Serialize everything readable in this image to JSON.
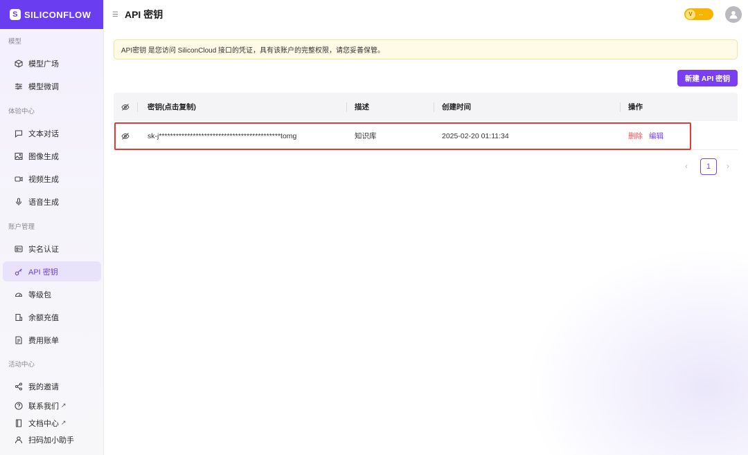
{
  "brand": {
    "name": "SILICONFLOW",
    "logo_color": "#6a3df0"
  },
  "sidebar": {
    "sections": [
      {
        "title": "模型",
        "items": [
          {
            "label": "模型广场",
            "icon": "cube-icon"
          },
          {
            "label": "模型微调",
            "icon": "sliders-icon"
          }
        ]
      },
      {
        "title": "体验中心",
        "items": [
          {
            "label": "文本对话",
            "icon": "chat-icon"
          },
          {
            "label": "图像生成",
            "icon": "image-icon"
          },
          {
            "label": "视频生成",
            "icon": "video-icon"
          },
          {
            "label": "语音生成",
            "icon": "mic-icon"
          }
        ]
      },
      {
        "title": "账户管理",
        "items": [
          {
            "label": "实名认证",
            "icon": "id-card-icon"
          },
          {
            "label": "API 密钥",
            "icon": "key-icon",
            "active": true
          },
          {
            "label": "等级包",
            "icon": "gauge-icon"
          },
          {
            "label": "余额充值",
            "icon": "wallet-icon"
          },
          {
            "label": "费用账单",
            "icon": "bill-icon"
          }
        ]
      },
      {
        "title": "活动中心",
        "items": [
          {
            "label": "我的邀请",
            "icon": "share-icon"
          },
          {
            "label": "联系我们",
            "icon": "help-circle-icon",
            "external": true
          },
          {
            "label": "文档中心",
            "icon": "book-icon",
            "external": true
          },
          {
            "label": "扫码加小助手",
            "icon": "user-icon"
          }
        ]
      }
    ],
    "external_mark": "↗"
  },
  "header": {
    "title": "API 密钥",
    "vip_badge": "--"
  },
  "notice": {
    "text": "API密钥 是您访问 SiliconCloud 接口的凭证，具有该账户的完整权限，请您妥善保管。"
  },
  "actions": {
    "new_key_label": "新建 API 密钥"
  },
  "table": {
    "columns": {
      "key": "密钥(点击复制)",
      "desc": "描述",
      "created": "创建时间",
      "ops": "操作"
    },
    "rows": [
      {
        "key": "sk-j*******************************************tomg",
        "desc": "知识库",
        "created": "2025-02-20 01:11:34",
        "delete_label": "删除",
        "edit_label": "编辑"
      }
    ]
  },
  "pagination": {
    "current_page": "1",
    "prev": "‹",
    "next": "›"
  },
  "colors": {
    "accent": "#7a3ff0",
    "danger": "#f0565a",
    "highlight": "#e53935",
    "notice_bg": "#fffbe6"
  }
}
